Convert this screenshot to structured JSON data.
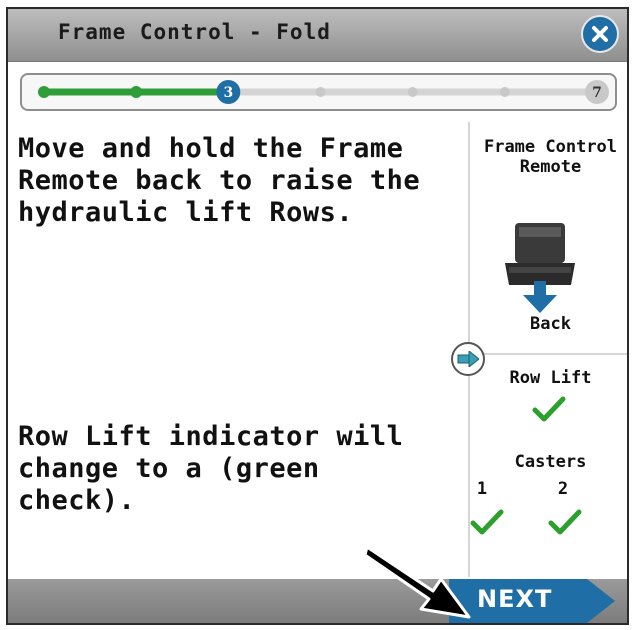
{
  "title": "Frame Control - Fold",
  "progress": {
    "current_step": "3",
    "total_steps": "7",
    "step_count": 7,
    "current_index": 3,
    "completed_color": "#2e9d3a",
    "current_color": "#1f6ea6",
    "pending_color": "#d4d4d4"
  },
  "instructions": {
    "top": "Move and hold the Frame Remote back to raise the hydraulic lift Rows.",
    "bottom": "Row Lift indicator will change to a (green check)."
  },
  "side_panel": {
    "remote_title": "Frame Control Remote",
    "back_label": "Back",
    "row_lift_label": "Row Lift",
    "casters_label": "Casters",
    "caster_1": "1",
    "caster_2": "2"
  },
  "footer": {
    "next_label": "NEXT"
  },
  "colors": {
    "accent": "#1f6ea6",
    "check": "#2ca02c",
    "title_bar": "#a8a8a8"
  },
  "icons": [
    "close-icon",
    "remote-icon",
    "down-arrow-icon",
    "right-arrow-icon",
    "check-icon",
    "pointer-arrow-icon"
  ]
}
